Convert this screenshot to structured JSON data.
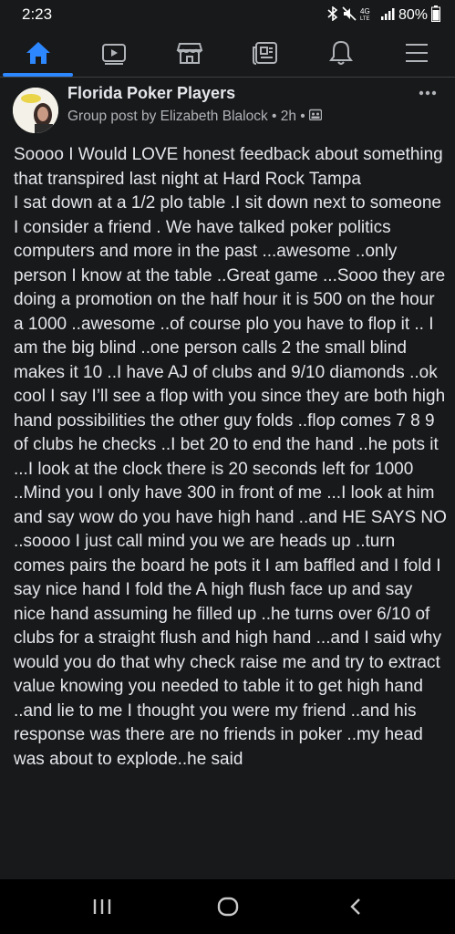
{
  "status_bar": {
    "time": "2:23",
    "battery": "80%",
    "icons": [
      "bluetooth-icon",
      "mute-icon",
      "4g-lte-icon",
      "signal-icon",
      "battery-icon"
    ]
  },
  "nav_tabs": [
    {
      "icon": "home-icon",
      "active": true
    },
    {
      "icon": "watch-icon",
      "active": false
    },
    {
      "icon": "marketplace-icon",
      "active": false
    },
    {
      "icon": "news-icon",
      "active": false
    },
    {
      "icon": "notifications-bell-icon",
      "active": false
    },
    {
      "icon": "menu-icon",
      "active": false
    }
  ],
  "post": {
    "group_name": "Florida Poker Players",
    "meta_text": "Group post by Elizabeth Blalock • 2h • ",
    "privacy_icon": "group-privacy-icon",
    "body": "Soooo I Would LOVE honest feedback about something that transpired last night at Hard Rock Tampa\nI sat down at a 1/2 plo table .I sit down next to someone I consider a friend . We have talked poker politics computers and more in the past ...awesome ..only person I know at the table ..Great game ...Sooo they are doing a promotion on the half hour it is 500 on the hour a 1000 ..awesome ..of course plo you have to flop it .. I am the big blind ..one person calls 2 the small blind makes it 10 ..I have AJ of clubs and 9/10 diamonds ..ok cool I say I’ll see a flop with you since they are both high hand possibilities the other guy folds ..flop comes 7 8 9 of clubs he checks ..I bet 20 to end the hand ..he pots it ...I look at the clock there is 20 seconds left for 1000 ..Mind you I only have 300 in front of me ...I look at him and say wow do you have high hand ..and HE SAYS NO ..soooo I just call mind you we are heads up ..turn comes pairs the board he pots it I am baffled and I fold I say nice hand I fold the A high flush face up and say nice hand assuming he filled up ..he turns over 6/10 of clubs for a straight flush and high hand ...and I said why would you do that why check raise me and try to extract value knowing you needed to table it to get high hand ..and lie to me I thought you were my friend ..and his response was there are no friends in poker ..my head was about to explode..he said"
  },
  "system_nav": {
    "icons": [
      "recent-apps-icon",
      "home-circle-icon",
      "back-icon"
    ]
  },
  "colors": {
    "background": "#18191a",
    "text": "#e4e6eb",
    "secondary_text": "#b0b3b8",
    "accent": "#2d88ff"
  }
}
